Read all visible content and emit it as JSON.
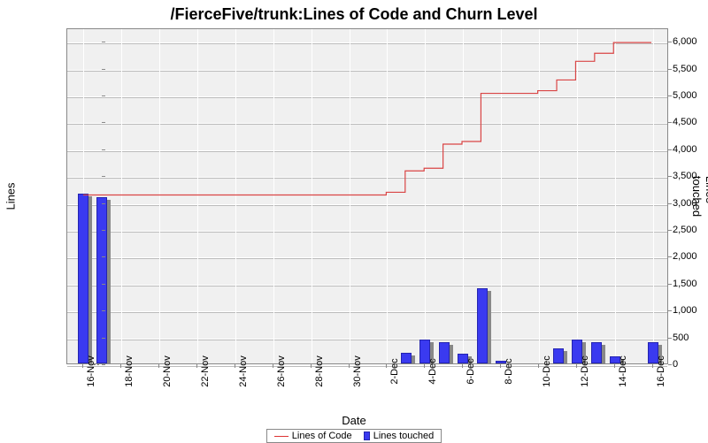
{
  "title": "/FierceFive/trunk:Lines of Code and Churn Level",
  "axis_left": "Lines",
  "axis_right": "Lines touched",
  "axis_bottom": "Date",
  "legend": {
    "loc": "Lines of Code",
    "touched": "Lines touched"
  },
  "chart_data": {
    "type": "bar+line",
    "xlabel": "Date",
    "ylabel_left": "Lines",
    "ylabel_right": "Lines touched",
    "ylim_left": [
      0,
      6250
    ],
    "ylim_right": [
      0,
      6250
    ],
    "x_ticks": [
      "16-Nov",
      "18-Nov",
      "20-Nov",
      "22-Nov",
      "24-Nov",
      "26-Nov",
      "28-Nov",
      "30-Nov",
      "2-Dec",
      "4-Dec",
      "6-Dec",
      "8-Dec",
      "10-Dec",
      "12-Dec",
      "14-Dec",
      "16-Dec"
    ],
    "y_ticks_left": [
      0,
      500,
      1000,
      1500,
      2000,
      2500,
      3000,
      3500,
      4000,
      4500,
      5000,
      5500,
      6000
    ],
    "y_ticks_right": [
      0,
      500,
      1000,
      1500,
      2000,
      2500,
      3000,
      3500,
      4000,
      4500,
      5000,
      5500,
      6000
    ],
    "series": [
      {
        "name": "Lines of Code",
        "kind": "line",
        "axis": "left",
        "data": [
          {
            "x": "16-Nov",
            "y": 3150
          },
          {
            "x": "17-Nov",
            "y": 3150
          },
          {
            "x": "1-Dec",
            "y": 3150
          },
          {
            "x": "2-Dec",
            "y": 3200
          },
          {
            "x": "3-Dec",
            "y": 3600
          },
          {
            "x": "4-Dec",
            "y": 3650
          },
          {
            "x": "5-Dec",
            "y": 4100
          },
          {
            "x": "6-Dec",
            "y": 4150
          },
          {
            "x": "7-Dec",
            "y": 5050
          },
          {
            "x": "8-Dec",
            "y": 5050
          },
          {
            "x": "10-Dec",
            "y": 5100
          },
          {
            "x": "11-Dec",
            "y": 5300
          },
          {
            "x": "12-Dec",
            "y": 5650
          },
          {
            "x": "13-Dec",
            "y": 5800
          },
          {
            "x": "14-Dec",
            "y": 6000
          },
          {
            "x": "16-Dec",
            "y": 6000
          }
        ]
      },
      {
        "name": "Lines touched",
        "kind": "bar",
        "axis": "right",
        "data": [
          {
            "x": "16-Nov",
            "y": 3150
          },
          {
            "x": "17-Nov",
            "y": 3100
          },
          {
            "x": "3-Dec",
            "y": 200
          },
          {
            "x": "4-Dec",
            "y": 450
          },
          {
            "x": "5-Dec",
            "y": 400
          },
          {
            "x": "6-Dec",
            "y": 180
          },
          {
            "x": "7-Dec",
            "y": 1400
          },
          {
            "x": "8-Dec",
            "y": 50
          },
          {
            "x": "11-Dec",
            "y": 280
          },
          {
            "x": "12-Dec",
            "y": 450
          },
          {
            "x": "13-Dec",
            "y": 400
          },
          {
            "x": "14-Dec",
            "y": 130
          },
          {
            "x": "16-Dec",
            "y": 400
          }
        ]
      }
    ]
  }
}
